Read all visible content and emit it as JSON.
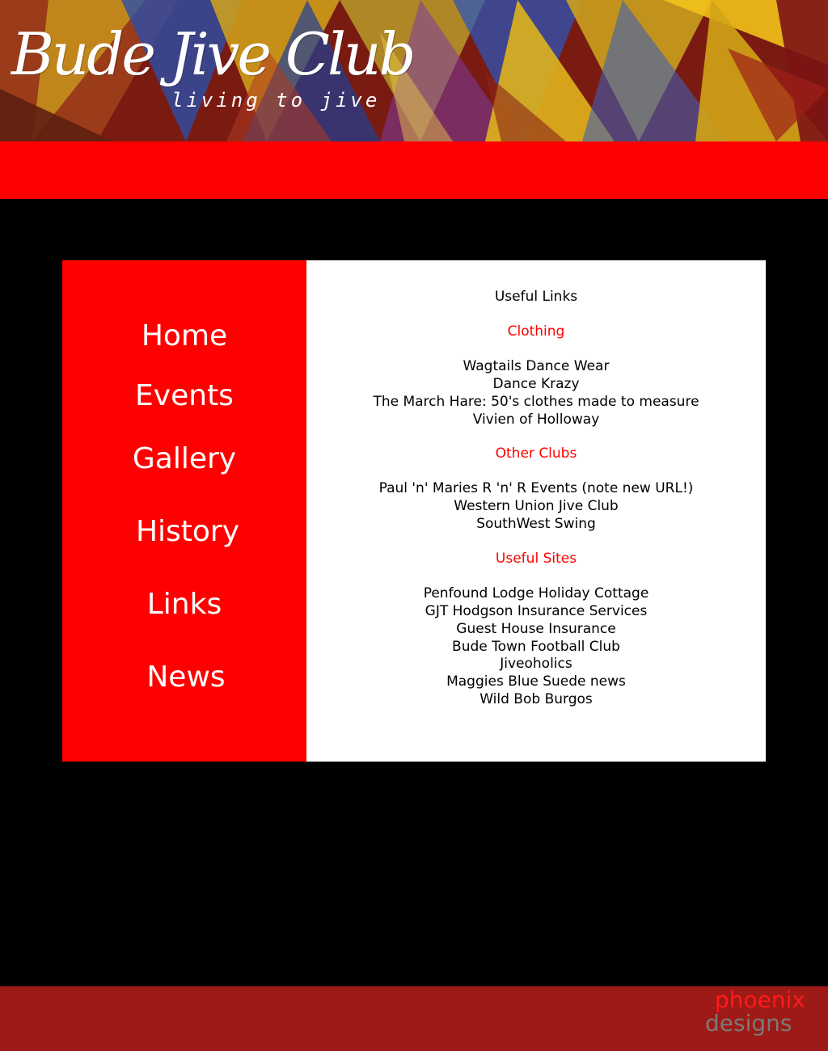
{
  "header": {
    "logo_text": "Bude Jive Club",
    "tagline": "living to jive",
    "colors": {
      "band": "#ff0000",
      "background": "#000000",
      "footer": "#9e1a16"
    }
  },
  "nav": {
    "items": [
      {
        "label": "Home"
      },
      {
        "label": "Events"
      },
      {
        "label": "Gallery"
      },
      {
        "label": "History"
      },
      {
        "label": "Links"
      },
      {
        "label": "News"
      }
    ]
  },
  "content": {
    "title": "Useful Links",
    "sections": [
      {
        "heading": "Clothing",
        "links": [
          "Wagtails Dance Wear",
          "Dance Krazy",
          "The March Hare: 50's clothes made to measure",
          "Vivien of Holloway"
        ]
      },
      {
        "heading": "Other Clubs",
        "links": [
          "Paul 'n' Maries R 'n' R Events (note new URL!)",
          "Western Union Jive Club",
          "SouthWest Swing"
        ]
      },
      {
        "heading": "Useful Sites",
        "links": [
          "Penfound Lodge Holiday Cottage",
          "GJT Hodgson Insurance Services",
          "Guest House Insurance",
          "Bude Town Football Club",
          "Jiveoholics",
          "Maggies Blue Suede news",
          "Wild Bob Burgos"
        ]
      }
    ]
  },
  "footer": {
    "credit_line1": "phoenix",
    "credit_line2": "designs"
  }
}
